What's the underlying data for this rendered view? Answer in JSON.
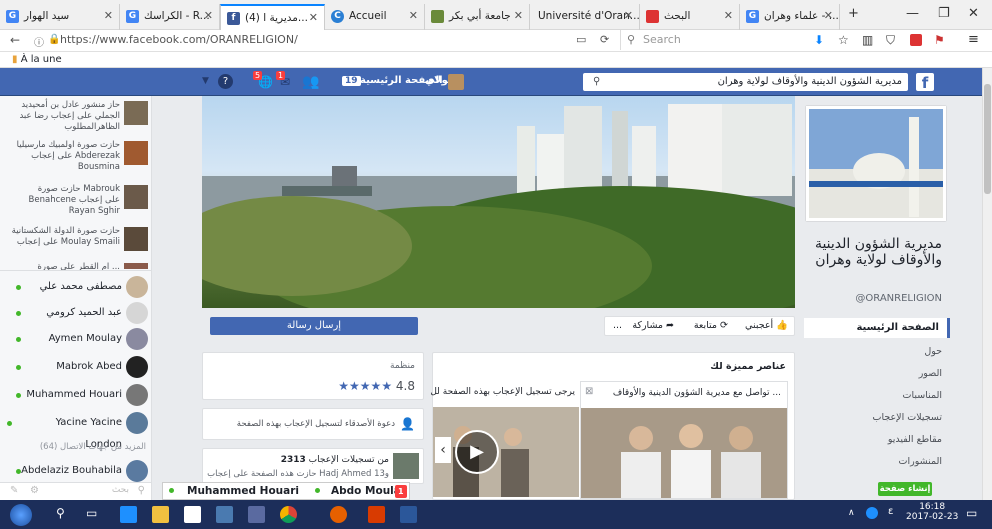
{
  "browser": {
    "tabs": [
      {
        "title": "سيد الهوار",
        "icon": "G"
      },
      {
        "title": "الكراسك - R...",
        "icon": "G"
      },
      {
        "title": "(4) مديرية ا...",
        "icon": "f"
      },
      {
        "title": "Accueil",
        "icon": "C"
      },
      {
        "title": "جامعة أبي بكر",
        "icon": ""
      },
      {
        "title": "Université d'Oran...",
        "icon": ""
      },
      {
        "title": "البحث",
        "icon": ""
      },
      {
        "title": "علماء وهران - ...",
        "icon": "G"
      }
    ],
    "url": "https://www.facebook.com/ORANRELIGION/",
    "search_placeholder": "Search",
    "bookmark": "À la une"
  },
  "fb": {
    "search_value": "مديرية الشؤون الدينية والأوقاف لولاية وهران",
    "user": "مولاي",
    "home": "الصفحة الرئيسية",
    "home_count": "19",
    "notif_counts": [
      "5",
      "1"
    ],
    "page": {
      "name": "مديرية الشؤون الدينية والأوقاف لولاية وهران",
      "handle": "@ORANRELIGION",
      "nav": [
        "الصفحة الرئيسية",
        "حول",
        "الصور",
        "المناسبات",
        "تسجيلات الإعجاب",
        "مقاطع الفيديو",
        "المنشورات"
      ],
      "create_page": "إنشاء صفحة"
    },
    "actions": {
      "like": "أعجبني",
      "follow": "متابعة",
      "share": "مشاركة",
      "more": "...",
      "message": "إرسال رسالة"
    },
    "about": {
      "category": "منظمة",
      "rating": "4.8",
      "stars": "★★★★★"
    },
    "invite": "دعوة الأصدقاء لتسجيل الإعجاب بهذه الصفحة",
    "likes": {
      "count": "2313",
      "text": "من تسجيلات الإعجاب",
      "friend_line": "حازت هذه الصفحة على إعجاب Hadj Ahmed و13"
    },
    "featured": {
      "title": "عناصر مميزة لك",
      "post1": "تواصل مع مديرية الشؤون الدينية والأوقاف ...",
      "post2": "يرجى تسجيل الإعجاب بهذه الصفحة لل"
    },
    "ticker": [
      "حاز منشور عادل بن أمحيديد الجملي على إعجاب رضا عبد الظاهرالمطلوب",
      "حازت صورة اولمبيك مارسيليا على إعجاب Abderezak Bousmina",
      "حازت صورة Mabrouk Benahcene على إعجاب Rayan Sghir",
      "حازت صورة الدولة الشكستانية على إعجاب Moulay Smaili",
      "ام القطر على صورة ..."
    ],
    "friends": [
      "مصطفى محمد علي",
      "عبد الحميد كرومي",
      "Aymen Moulay",
      "Mabrok Abed",
      "Muhammed Houari",
      "Yacine Yacine London"
    ],
    "more_contacts": "المزيد من جهات الاتصال (64)",
    "friend_last": "Abdelaziz Bouhabila",
    "chat_search": "بحث",
    "chat_tabs": [
      "Muhammed Houari",
      "Abdo Moulay"
    ],
    "chat_tab_badge": "1"
  },
  "taskbar": {
    "time": "16:18",
    "date": "2017-02-23"
  }
}
